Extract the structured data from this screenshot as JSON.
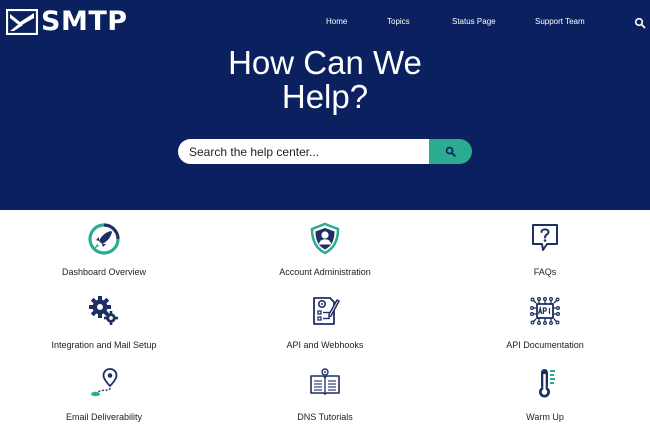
{
  "header": {
    "logo_text": "SMTP",
    "nav": [
      "Home",
      "Topics",
      "Status Page",
      "Support Team"
    ]
  },
  "hero": {
    "headline_line1": "How Can We",
    "headline_line2": "Help?"
  },
  "search": {
    "placeholder": "Search the help center..."
  },
  "topics": [
    {
      "label": "Dashboard Overview",
      "icon": "rocket-icon"
    },
    {
      "label": "Account Administration",
      "icon": "user-shield-icon"
    },
    {
      "label": "FAQs",
      "icon": "question-bubble-icon"
    },
    {
      "label": "Integration and Mail Setup",
      "icon": "gears-icon"
    },
    {
      "label": "API and Webhooks",
      "icon": "document-gear-icon"
    },
    {
      "label": "API Documentation",
      "icon": "api-chip-icon"
    },
    {
      "label": "Email Deliverability",
      "icon": "location-path-icon"
    },
    {
      "label": "DNS Tutorials",
      "icon": "open-book-icon"
    },
    {
      "label": "Warm Up",
      "icon": "thermometer-icon"
    }
  ],
  "colors": {
    "hero_background": "#0b215f",
    "accent": "#2bab8f",
    "icon_primary": "#1e2f64"
  }
}
